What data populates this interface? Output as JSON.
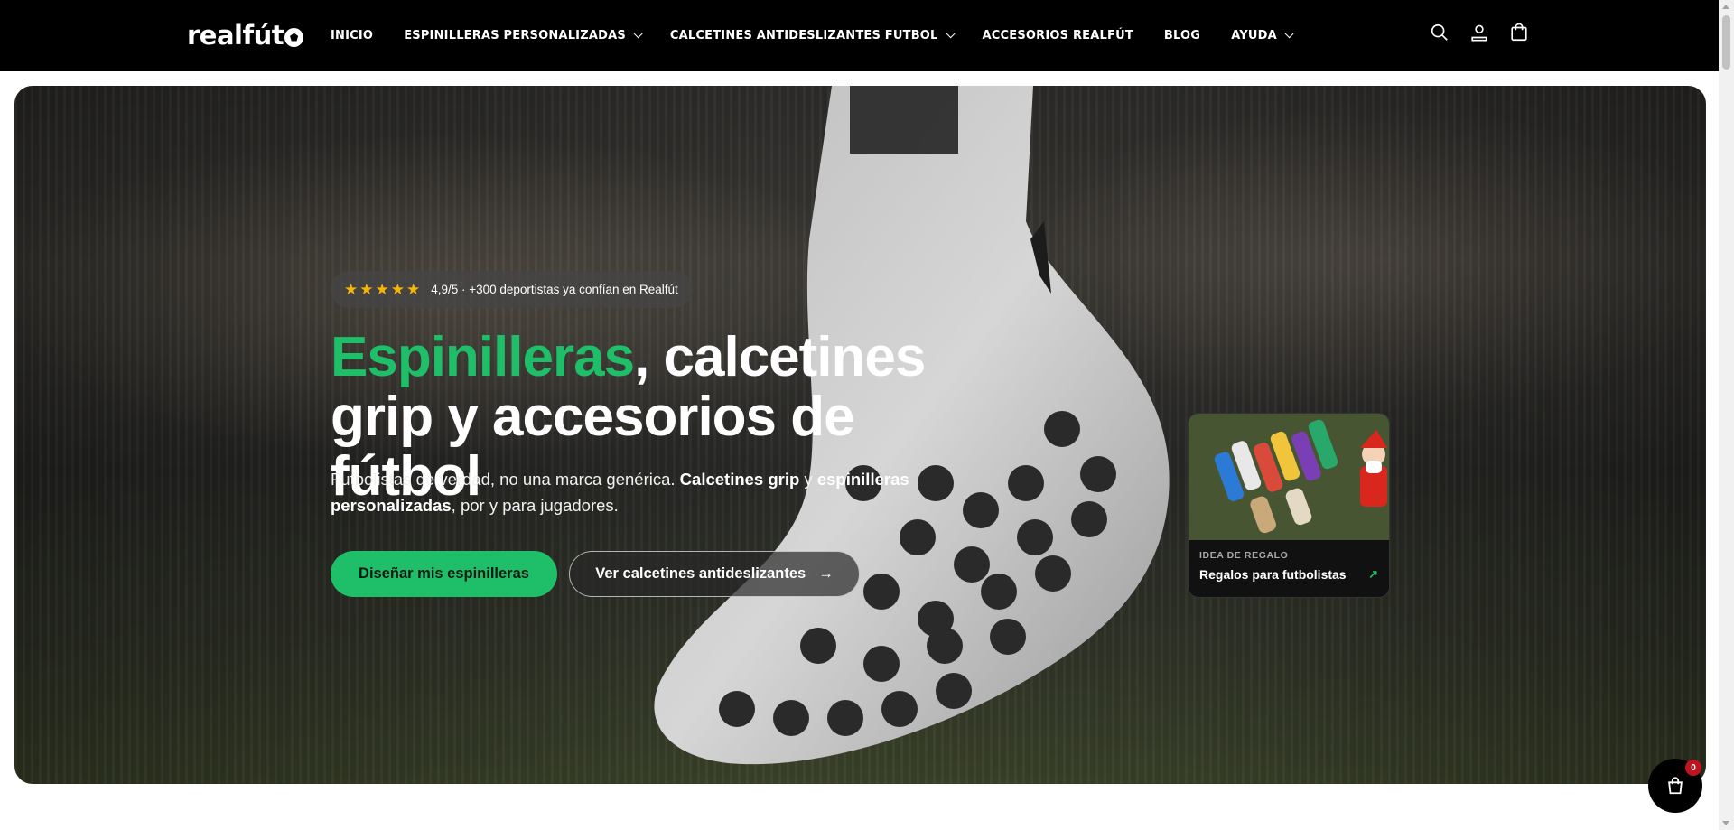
{
  "header": {
    "logo_text": "realfút",
    "nav": [
      {
        "label": "INICIO",
        "has_dropdown": false
      },
      {
        "label": "ESPINILLERAS PERSONALIZADAS",
        "has_dropdown": true
      },
      {
        "label": "CALCETINES ANTIDESLIZANTES FUTBOL",
        "has_dropdown": true
      },
      {
        "label": "ACCESORIOS REALFÚT",
        "has_dropdown": false
      },
      {
        "label": "BLOG",
        "has_dropdown": false
      },
      {
        "label": "AYUDA",
        "has_dropdown": true
      }
    ],
    "icons": [
      "search-icon",
      "account-icon",
      "cart-icon"
    ]
  },
  "hero": {
    "rating": {
      "stars": "★★★★★",
      "text": "4,9/5 · +300 deportistas ya confían en Realfút",
      "star_color": "#f5b50a"
    },
    "title_accent": "Espinilleras",
    "title_rest_line1": ", calcetines",
    "title_line2": "grip y accesorios de fútbol",
    "subtitle_part1": "Futbolistas de verdad, no una marca genérica. ",
    "subtitle_bold1": "Calcetines grip",
    "subtitle_part2": " y ",
    "subtitle_bold2": "espinilleras personalizadas",
    "subtitle_part3": ", por y para jugadores.",
    "primary_button": "Diseñar mis espinilleras",
    "secondary_button": "Ver calcetines antideslizantes",
    "secondary_button_arrow": "→",
    "gift_card": {
      "kicker": "IDEA DE REGALO",
      "title": "Regalos para futbolistas",
      "arrow": "↗"
    }
  },
  "cart_bubble": {
    "count": "0"
  },
  "colors": {
    "accent": "#1fbf6a",
    "header_bg": "#000000",
    "badge": "#c1121f"
  }
}
